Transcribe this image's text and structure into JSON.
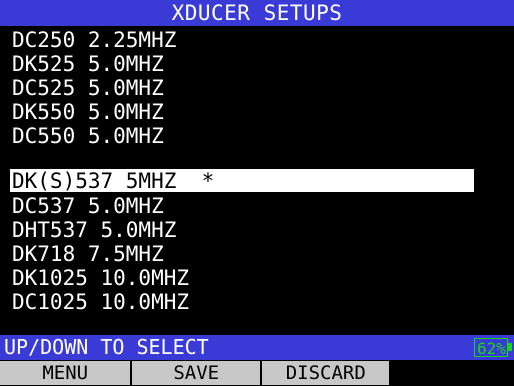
{
  "header": {
    "title": "XDUCER SETUPS"
  },
  "transducers": [
    {
      "label": "DC250 2.25MHZ",
      "selected": false
    },
    {
      "label": "DK525 5.0MHZ",
      "selected": false
    },
    {
      "label": "DC525 5.0MHZ",
      "selected": false
    },
    {
      "label": "DK550 5.0MHZ",
      "selected": false
    },
    {
      "label": "DC550 5.0MHZ",
      "selected": false
    },
    {
      "label": "DK(S)537 5MHZ  *",
      "selected": true
    },
    {
      "label": "DC537 5.0MHZ",
      "selected": false
    },
    {
      "label": "DHT537 5.0MHZ",
      "selected": false
    },
    {
      "label": "DK718 7.5MHZ",
      "selected": false
    },
    {
      "label": "DK1025 10.0MHZ",
      "selected": false
    },
    {
      "label": "DC1025 10.0MHZ",
      "selected": false
    }
  ],
  "status": {
    "hint": "UP/DOWN TO SELECT",
    "battery_percent": "62%"
  },
  "softkeys": {
    "key1": "MENU",
    "key2": "SAVE",
    "key3": "DISCARD",
    "key4": ""
  },
  "colors": {
    "bar_blue": "#3a3ad6",
    "battery_green": "#17d617",
    "softkey_gray": "#c8c8c8"
  }
}
